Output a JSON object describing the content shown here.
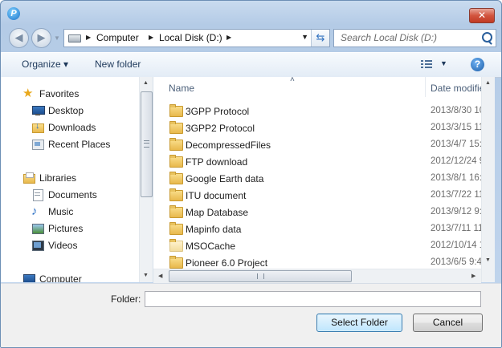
{
  "window": {
    "close_glyph": "✕",
    "app_icon_letter": "P"
  },
  "nav": {
    "back_glyph": "◀",
    "forward_glyph": "▶",
    "breadcrumb": [
      "Computer",
      "Local Disk (D:)"
    ],
    "search_placeholder": "Search Local Disk (D:)"
  },
  "toolbar": {
    "organize_label": "Organize ▾",
    "new_folder_label": "New folder",
    "view_dd": "▼",
    "help_glyph": "?"
  },
  "sidebar": {
    "favorites_label": "Favorites",
    "favorites": [
      {
        "label": "Desktop",
        "icon": "desktop-icon"
      },
      {
        "label": "Downloads",
        "icon": "downloads-icon"
      },
      {
        "label": "Recent Places",
        "icon": "recent-places-icon"
      }
    ],
    "libraries_label": "Libraries",
    "libraries": [
      {
        "label": "Documents",
        "icon": "documents-icon"
      },
      {
        "label": "Music",
        "icon": "music-icon"
      },
      {
        "label": "Pictures",
        "icon": "pictures-icon"
      },
      {
        "label": "Videos",
        "icon": "videos-icon"
      }
    ],
    "computer_label": "Computer"
  },
  "file_list": {
    "col_name": "Name",
    "col_date": "Date modified",
    "sort_glyph": "˄",
    "rows": [
      {
        "name": "3GPP Protocol",
        "date": "2013/8/30 10"
      },
      {
        "name": "3GPP2 Protocol",
        "date": "2013/3/15 11"
      },
      {
        "name": "DecompressedFiles",
        "date": "2013/4/7 15:"
      },
      {
        "name": "FTP download",
        "date": "2012/12/24 9"
      },
      {
        "name": "Google Earth data",
        "date": "2013/8/1 16:"
      },
      {
        "name": "ITU document",
        "date": "2013/7/22 11"
      },
      {
        "name": "Map Database",
        "date": "2013/9/12 9:"
      },
      {
        "name": "Mapinfo data",
        "date": "2013/7/11 11"
      },
      {
        "name": "MSOCache",
        "date": "2012/10/14 1"
      },
      {
        "name": "Pioneer 6.0 Project",
        "date": "2013/6/5 9:4"
      }
    ]
  },
  "bottom": {
    "folder_label": "Folder:",
    "folder_value": "",
    "select_label": "Select Folder",
    "cancel_label": "Cancel"
  },
  "colors": {
    "accent": "#3c7fb1",
    "chrome": "#c2d6ee"
  }
}
